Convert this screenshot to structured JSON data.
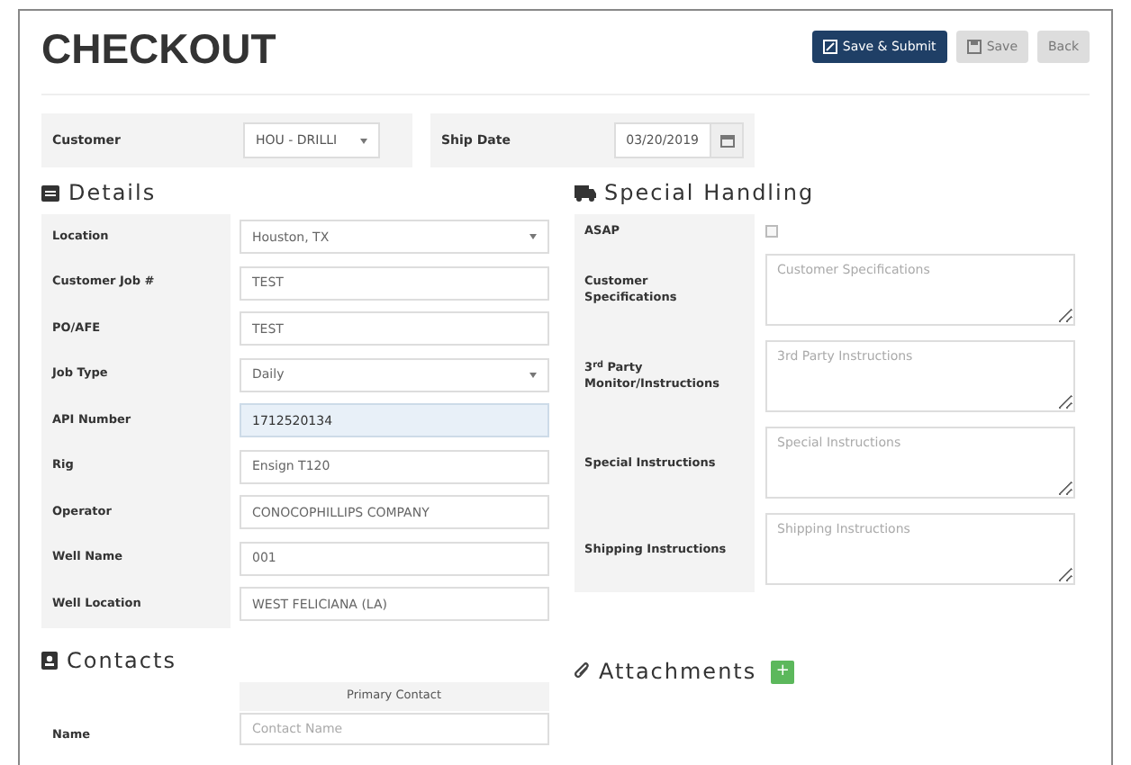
{
  "title": "CHECKOUT",
  "buttons": [
    {
      "label": "Save & Submit",
      "kind": "primary"
    },
    {
      "label": "Save",
      "kind": "save"
    },
    {
      "label": "Back",
      "kind": "plain"
    }
  ],
  "header_fields": [
    {
      "label": "Customer",
      "kind": "select",
      "value": "HOU - DRILLI"
    },
    {
      "label": "Ship Date",
      "kind": "date",
      "value": "03/20/2019"
    }
  ],
  "details": {
    "title": "Details",
    "fields": [
      {
        "label": "Location",
        "kind": "select",
        "value": "Houston, TX",
        "focused": false
      },
      {
        "label": "Customer Job #",
        "kind": "text",
        "value": "TEST",
        "focused": false
      },
      {
        "label": "PO/AFE",
        "kind": "text",
        "value": "TEST",
        "focused": false
      },
      {
        "label": "Job Type",
        "kind": "select",
        "value": "Daily",
        "focused": false
      },
      {
        "label": "API Number",
        "kind": "text",
        "value": "1712520134",
        "focused": true
      },
      {
        "label": "Rig",
        "kind": "text",
        "value": "Ensign T120",
        "focused": false
      },
      {
        "label": "Operator",
        "kind": "text",
        "value": "CONOCOPHILLIPS COMPANY",
        "focused": false
      },
      {
        "label": "Well Name",
        "kind": "text",
        "value": "001",
        "focused": false
      },
      {
        "label": "Well Location",
        "kind": "text",
        "value": "WEST FELICIANA (LA)",
        "focused": false
      }
    ]
  },
  "special_handling": {
    "title": "Special Handling",
    "fields": [
      {
        "label": "ASAP",
        "kind": "checkbox",
        "checked": false
      },
      {
        "label": "Customer Specifications",
        "kind": "textarea",
        "placeholder": "Customer Specifications"
      },
      {
        "label": "3$^{rd}$ Party Monitor/Instructions",
        "kind": "textarea",
        "placeholder": "3rd Party Instructions"
      },
      {
        "label": "Special Instructions",
        "kind": "textarea",
        "placeholder": "Special Instructions"
      },
      {
        "label": "Shipping Instructions",
        "kind": "textarea",
        "placeholder": "Shipping Instructions"
      }
    ]
  },
  "contacts": {
    "title": "Contacts",
    "column": "Primary Contact",
    "rows": [
      {
        "label": "Name",
        "placeholder": "Contact Name"
      }
    ]
  },
  "attachments": {
    "title": "Attachments",
    "add_button": "+"
  }
}
